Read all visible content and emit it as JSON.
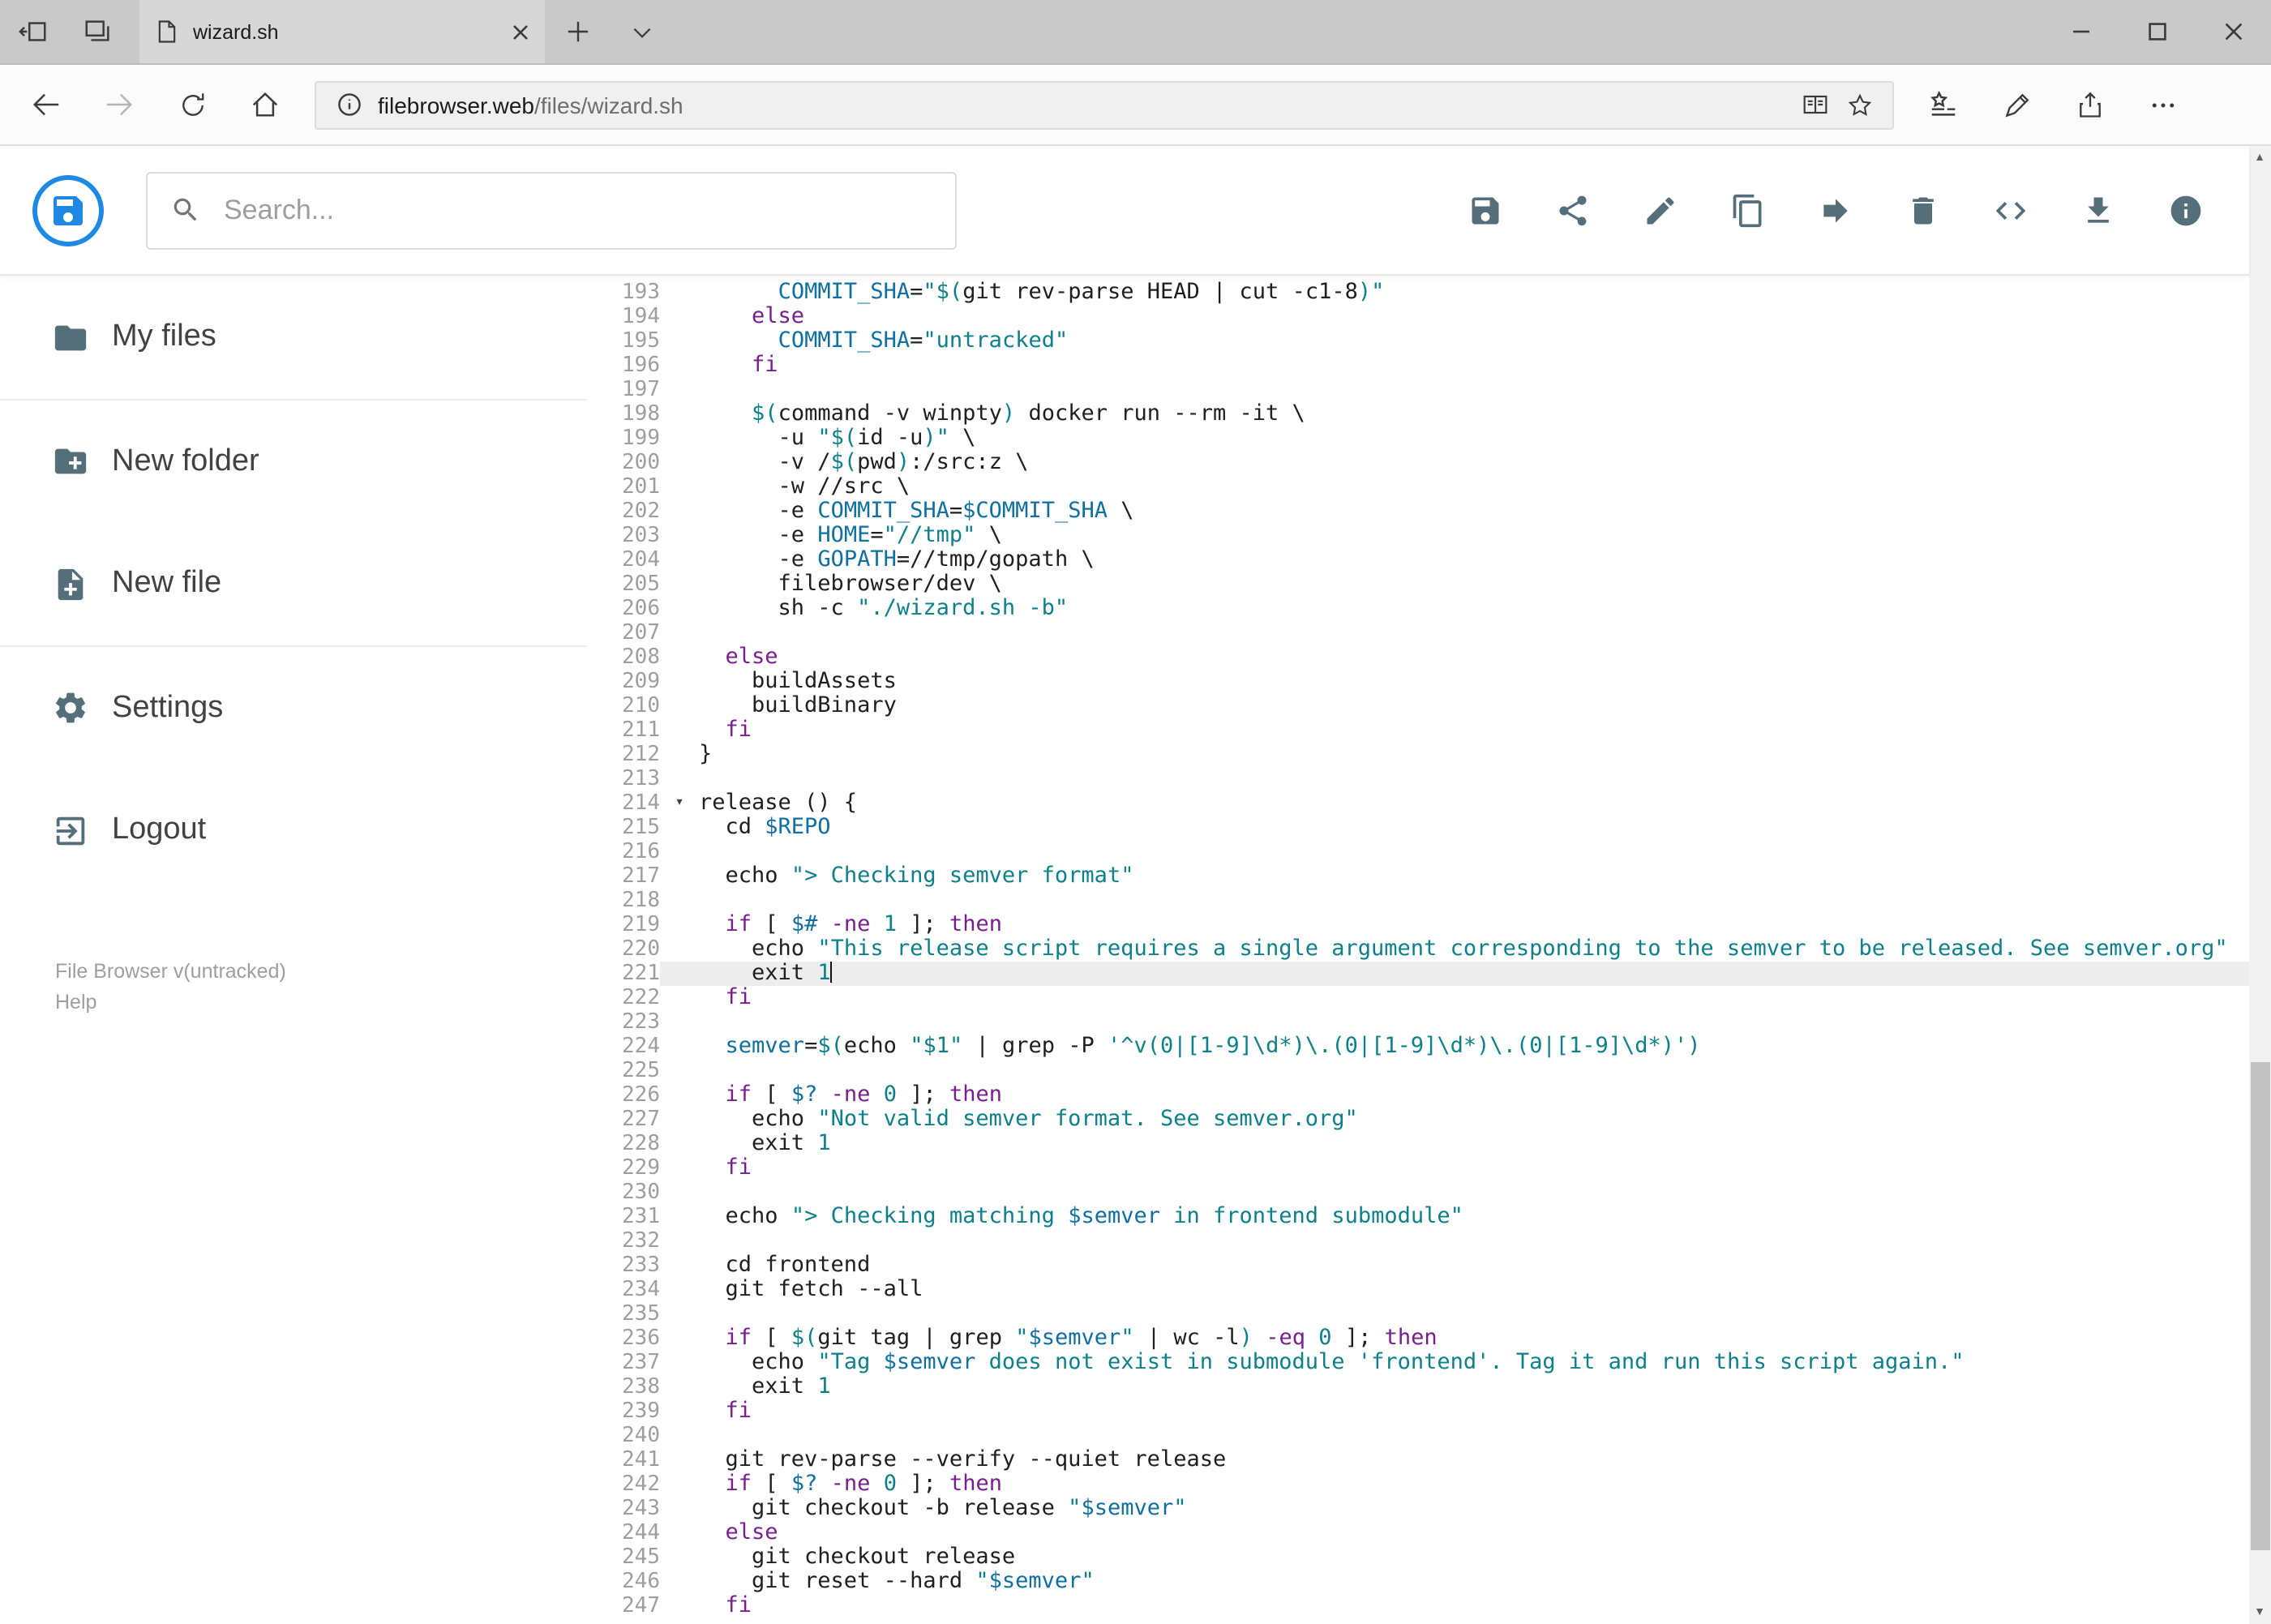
{
  "browser": {
    "tab": {
      "title": "wizard.sh"
    },
    "url": {
      "host": "filebrowser.web",
      "path": "/files/wizard.sh"
    },
    "nav_icons": [
      "back",
      "forward",
      "refresh",
      "home",
      "info",
      "reading-view",
      "favorite",
      "hub",
      "annotate",
      "share",
      "more"
    ],
    "tabbar_icons": [
      "set-tabs-aside",
      "tabs-you-set-aside",
      "new-tab",
      "tab-preview-chevron"
    ],
    "window_icons": [
      "minimize",
      "maximize",
      "close"
    ]
  },
  "header": {
    "search_placeholder": "Search...",
    "toolbar_icons": [
      "save",
      "share",
      "edit",
      "copy",
      "move",
      "delete",
      "code",
      "download",
      "info"
    ],
    "logo_color": "#1e88e5",
    "icon_color": "#546e7a"
  },
  "sidebar": {
    "items": [
      {
        "label": "My files",
        "icon": "folder"
      },
      {
        "label": "New folder",
        "icon": "new-folder"
      },
      {
        "label": "New file",
        "icon": "new-file"
      },
      {
        "label": "Settings",
        "icon": "settings"
      },
      {
        "label": "Logout",
        "icon": "logout"
      }
    ],
    "version": "File Browser v(untracked)",
    "help": "Help"
  },
  "editor": {
    "active_line": 221,
    "fold_line": 214,
    "colors": {
      "plain": "#1f1f1f",
      "kw": "#781f8e",
      "str": "#0d808a",
      "var": "#0f6fa0",
      "num": "#0d808a"
    },
    "lines": [
      {
        "n": 193,
        "t": [
          [
            "p",
            "      "
          ],
          [
            "v",
            "COMMIT_SHA"
          ],
          [
            "p",
            "="
          ],
          [
            "s",
            "\"$("
          ],
          [
            "p",
            "git rev-parse HEAD | cut -c1-8"
          ],
          [
            "s",
            ")\""
          ]
        ]
      },
      {
        "n": 194,
        "t": [
          [
            "p",
            "    "
          ],
          [
            "k",
            "else"
          ]
        ]
      },
      {
        "n": 195,
        "t": [
          [
            "p",
            "      "
          ],
          [
            "v",
            "COMMIT_SHA"
          ],
          [
            "p",
            "="
          ],
          [
            "s",
            "\"untracked\""
          ]
        ]
      },
      {
        "n": 196,
        "t": [
          [
            "p",
            "    "
          ],
          [
            "k",
            "fi"
          ]
        ]
      },
      {
        "n": 197,
        "t": []
      },
      {
        "n": 198,
        "t": [
          [
            "p",
            "    "
          ],
          [
            "s",
            "$("
          ],
          [
            "p",
            "command -v winpty"
          ],
          [
            "s",
            ")"
          ],
          [
            "p",
            " docker run --rm -it \\"
          ]
        ]
      },
      {
        "n": 199,
        "t": [
          [
            "p",
            "      -u "
          ],
          [
            "s",
            "\"$("
          ],
          [
            "p",
            "id -u"
          ],
          [
            "s",
            ")\""
          ],
          [
            "p",
            " \\"
          ]
        ]
      },
      {
        "n": 200,
        "t": [
          [
            "p",
            "      -v /"
          ],
          [
            "s",
            "$("
          ],
          [
            "p",
            "pwd"
          ],
          [
            "s",
            ")"
          ],
          [
            "p",
            ":/src:z \\"
          ]
        ]
      },
      {
        "n": 201,
        "t": [
          [
            "p",
            "      -w //src \\"
          ]
        ]
      },
      {
        "n": 202,
        "t": [
          [
            "p",
            "      -e "
          ],
          [
            "v",
            "COMMIT_SHA"
          ],
          [
            "p",
            "="
          ],
          [
            "v",
            "$COMMIT_SHA"
          ],
          [
            "p",
            " \\"
          ]
        ]
      },
      {
        "n": 203,
        "t": [
          [
            "p",
            "      -e "
          ],
          [
            "v",
            "HOME"
          ],
          [
            "p",
            "="
          ],
          [
            "s",
            "\"//tmp\""
          ],
          [
            "p",
            " \\"
          ]
        ]
      },
      {
        "n": 204,
        "t": [
          [
            "p",
            "      -e "
          ],
          [
            "v",
            "GOPATH"
          ],
          [
            "p",
            "=//tmp/gopath \\"
          ]
        ]
      },
      {
        "n": 205,
        "t": [
          [
            "p",
            "      filebrowser/dev \\"
          ]
        ]
      },
      {
        "n": 206,
        "t": [
          [
            "p",
            "      sh -c "
          ],
          [
            "s",
            "\"./wizard.sh -b\""
          ]
        ]
      },
      {
        "n": 207,
        "t": []
      },
      {
        "n": 208,
        "t": [
          [
            "p",
            "  "
          ],
          [
            "k",
            "else"
          ]
        ]
      },
      {
        "n": 209,
        "t": [
          [
            "p",
            "    buildAssets"
          ]
        ]
      },
      {
        "n": 210,
        "t": [
          [
            "p",
            "    buildBinary"
          ]
        ]
      },
      {
        "n": 211,
        "t": [
          [
            "p",
            "  "
          ],
          [
            "k",
            "fi"
          ]
        ]
      },
      {
        "n": 212,
        "t": [
          [
            "p",
            "}"
          ]
        ]
      },
      {
        "n": 213,
        "t": []
      },
      {
        "n": 214,
        "t": [
          [
            "p",
            "release () {"
          ]
        ]
      },
      {
        "n": 215,
        "t": [
          [
            "p",
            "  cd "
          ],
          [
            "v",
            "$REPO"
          ]
        ]
      },
      {
        "n": 216,
        "t": []
      },
      {
        "n": 217,
        "t": [
          [
            "p",
            "  echo "
          ],
          [
            "s",
            "\"> Checking semver format\""
          ]
        ]
      },
      {
        "n": 218,
        "t": []
      },
      {
        "n": 219,
        "t": [
          [
            "p",
            "  "
          ],
          [
            "k",
            "if"
          ],
          [
            "p",
            " [ "
          ],
          [
            "v",
            "$#"
          ],
          [
            "p",
            " "
          ],
          [
            "o",
            "-ne"
          ],
          [
            "p",
            " "
          ],
          [
            "n",
            "1"
          ],
          [
            "p",
            " ]; "
          ],
          [
            "k",
            "then"
          ]
        ]
      },
      {
        "n": 220,
        "t": [
          [
            "p",
            "    echo "
          ],
          [
            "s",
            "\"This release script requires a single argument corresponding to the semver to be released. See semver.org\""
          ]
        ]
      },
      {
        "n": 221,
        "t": [
          [
            "p",
            "    exit "
          ],
          [
            "n",
            "1"
          ]
        ]
      },
      {
        "n": 222,
        "t": [
          [
            "p",
            "  "
          ],
          [
            "k",
            "fi"
          ]
        ]
      },
      {
        "n": 223,
        "t": []
      },
      {
        "n": 224,
        "t": [
          [
            "p",
            "  "
          ],
          [
            "v",
            "semver"
          ],
          [
            "p",
            "="
          ],
          [
            "s",
            "$("
          ],
          [
            "p",
            "echo "
          ],
          [
            "s",
            "\"$1\""
          ],
          [
            "p",
            " | grep -P "
          ],
          [
            "s",
            "'^v(0|[1-9]\\d*)\\.(0|[1-9]\\d*)\\.(0|[1-9]\\d*)')"
          ]
        ]
      },
      {
        "n": 225,
        "t": []
      },
      {
        "n": 226,
        "t": [
          [
            "p",
            "  "
          ],
          [
            "k",
            "if"
          ],
          [
            "p",
            " [ "
          ],
          [
            "v",
            "$?"
          ],
          [
            "p",
            " "
          ],
          [
            "o",
            "-ne"
          ],
          [
            "p",
            " "
          ],
          [
            "n",
            "0"
          ],
          [
            "p",
            " ]; "
          ],
          [
            "k",
            "then"
          ]
        ]
      },
      {
        "n": 227,
        "t": [
          [
            "p",
            "    echo "
          ],
          [
            "s",
            "\"Not valid semver format. See semver.org\""
          ]
        ]
      },
      {
        "n": 228,
        "t": [
          [
            "p",
            "    exit "
          ],
          [
            "n",
            "1"
          ]
        ]
      },
      {
        "n": 229,
        "t": [
          [
            "p",
            "  "
          ],
          [
            "k",
            "fi"
          ]
        ]
      },
      {
        "n": 230,
        "t": []
      },
      {
        "n": 231,
        "t": [
          [
            "p",
            "  echo "
          ],
          [
            "s",
            "\"> Checking matching "
          ],
          [
            "v",
            "$semver"
          ],
          [
            "s",
            " in frontend submodule\""
          ]
        ]
      },
      {
        "n": 232,
        "t": []
      },
      {
        "n": 233,
        "t": [
          [
            "p",
            "  cd frontend"
          ]
        ]
      },
      {
        "n": 234,
        "t": [
          [
            "p",
            "  git fetch --all"
          ]
        ]
      },
      {
        "n": 235,
        "t": []
      },
      {
        "n": 236,
        "t": [
          [
            "p",
            "  "
          ],
          [
            "k",
            "if"
          ],
          [
            "p",
            " [ "
          ],
          [
            "s",
            "$("
          ],
          [
            "p",
            "git tag | grep "
          ],
          [
            "s",
            "\""
          ],
          [
            "v",
            "$semver"
          ],
          [
            "s",
            "\""
          ],
          [
            "p",
            " | wc -l"
          ],
          [
            "s",
            ")"
          ],
          [
            "p",
            " "
          ],
          [
            "o",
            "-eq"
          ],
          [
            "p",
            " "
          ],
          [
            "n",
            "0"
          ],
          [
            "p",
            " ]; "
          ],
          [
            "k",
            "then"
          ]
        ]
      },
      {
        "n": 237,
        "t": [
          [
            "p",
            "    echo "
          ],
          [
            "s",
            "\"Tag "
          ],
          [
            "v",
            "$semver"
          ],
          [
            "s",
            " does not exist in submodule 'frontend'. Tag it and run this script again.\""
          ]
        ]
      },
      {
        "n": 238,
        "t": [
          [
            "p",
            "    exit "
          ],
          [
            "n",
            "1"
          ]
        ]
      },
      {
        "n": 239,
        "t": [
          [
            "p",
            "  "
          ],
          [
            "k",
            "fi"
          ]
        ]
      },
      {
        "n": 240,
        "t": []
      },
      {
        "n": 241,
        "t": [
          [
            "p",
            "  git rev-parse --verify --quiet release"
          ]
        ]
      },
      {
        "n": 242,
        "t": [
          [
            "p",
            "  "
          ],
          [
            "k",
            "if"
          ],
          [
            "p",
            " [ "
          ],
          [
            "v",
            "$?"
          ],
          [
            "p",
            " "
          ],
          [
            "o",
            "-ne"
          ],
          [
            "p",
            " "
          ],
          [
            "n",
            "0"
          ],
          [
            "p",
            " ]; "
          ],
          [
            "k",
            "then"
          ]
        ]
      },
      {
        "n": 243,
        "t": [
          [
            "p",
            "    git checkout -b release "
          ],
          [
            "s",
            "\""
          ],
          [
            "v",
            "$semver"
          ],
          [
            "s",
            "\""
          ]
        ]
      },
      {
        "n": 244,
        "t": [
          [
            "p",
            "  "
          ],
          [
            "k",
            "else"
          ]
        ]
      },
      {
        "n": 245,
        "t": [
          [
            "p",
            "    git checkout release"
          ]
        ]
      },
      {
        "n": 246,
        "t": [
          [
            "p",
            "    git reset --hard "
          ],
          [
            "s",
            "\""
          ],
          [
            "v",
            "$semver"
          ],
          [
            "s",
            "\""
          ]
        ]
      },
      {
        "n": 247,
        "t": [
          [
            "p",
            "  "
          ],
          [
            "k",
            "fi"
          ]
        ]
      }
    ]
  }
}
